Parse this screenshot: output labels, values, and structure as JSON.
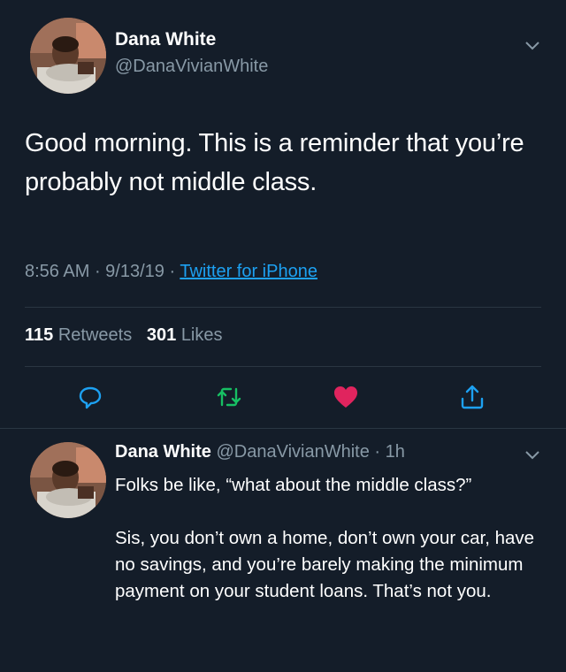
{
  "main_tweet": {
    "author_name": "Dana White",
    "author_handle": "@DanaVivianWhite",
    "text": "Good morning. This is a reminder that you’re probably not middle class.",
    "time": "8:56 AM",
    "date": "9/13/19",
    "source": "Twitter for iPhone",
    "retweet_count": "115",
    "retweet_label": "Retweets",
    "like_count": "301",
    "like_label": "Likes",
    "icons": {
      "menu": "chevron-down-icon",
      "reply": "reply-icon",
      "retweet": "retweet-icon",
      "like": "heart-icon",
      "share": "share-icon"
    },
    "colors": {
      "background": "#141d29",
      "secondary_text": "#8899a6",
      "link": "#1da1f2",
      "like": "#e0245e",
      "retweet": "#17bf63"
    }
  },
  "reply_tweet": {
    "author_name": "Dana White",
    "author_handle": "@DanaVivianWhite",
    "time_ago": "1h",
    "paragraph_1": "Folks be like, “what about the middle class?”",
    "paragraph_2": "Sis, you don’t own a home, don’t own your car, have no savings, and you’re barely making the minimum payment on your student loans. That’s not you."
  }
}
